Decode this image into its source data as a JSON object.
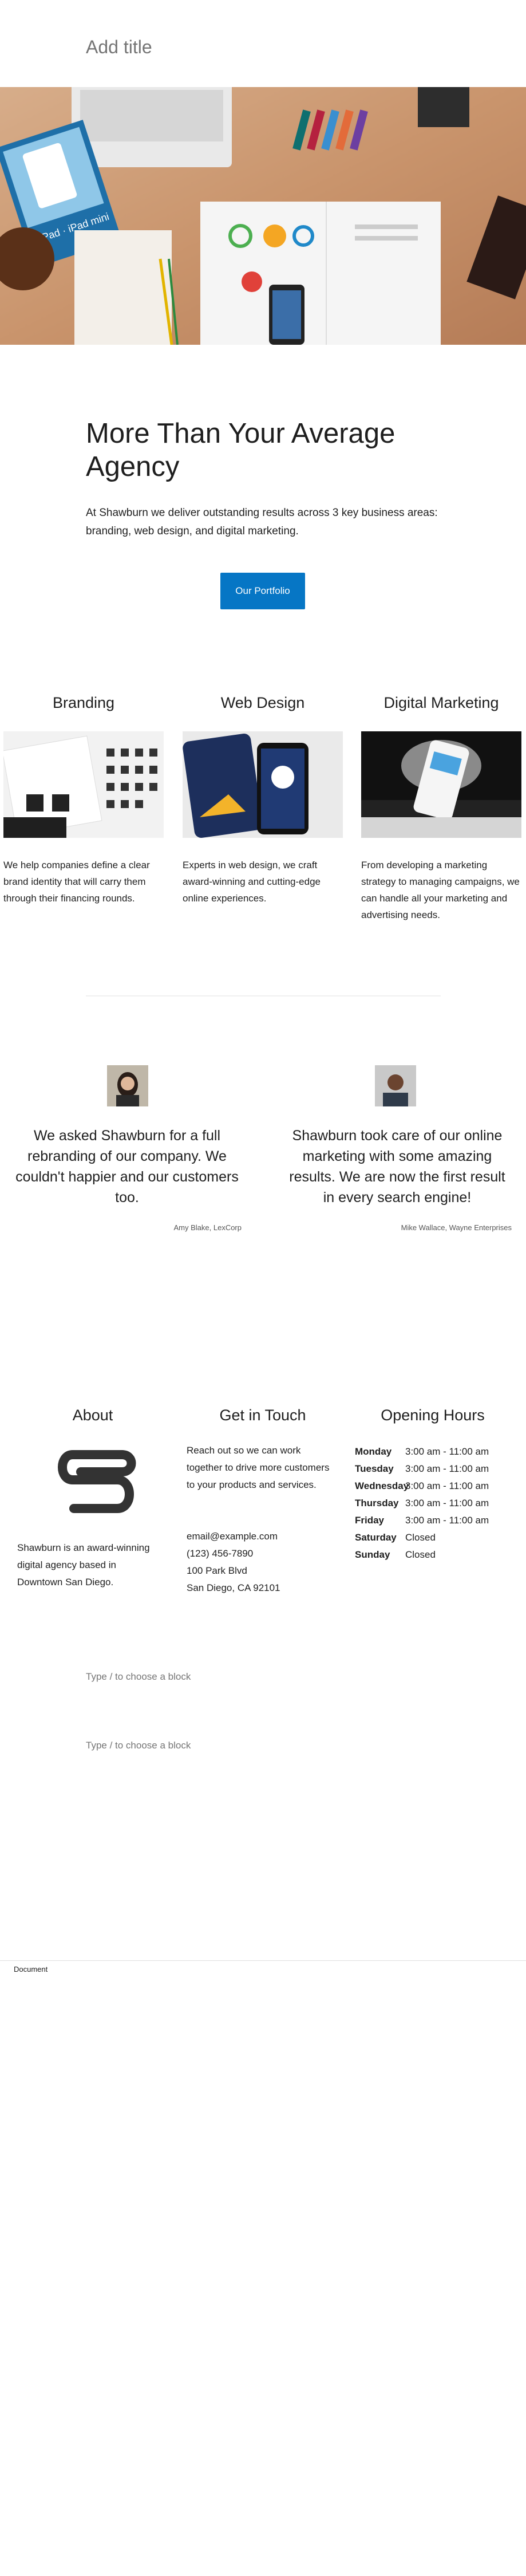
{
  "editor": {
    "title_placeholder": "Add title",
    "status_label": "Document",
    "block_placeholder_1": "Type / to choose a block",
    "block_placeholder_2": "Type / to choose a block"
  },
  "hero": {
    "icons": [
      "ipad-box-icon",
      "keyboard-icon",
      "magazine-icon",
      "phone-icon",
      "pencil-icon",
      "color-swatches-icon"
    ],
    "box_label": "iPad · iPad mini"
  },
  "intro": {
    "headline": "More Than Your Average Agency",
    "description": "At Shawburn we deliver outstanding results across 3 key business areas: branding, web design, and digital marketing.",
    "button_label": "Our Portfolio",
    "button_color": "#0676c5"
  },
  "services": [
    {
      "title": "Branding",
      "text": "We help companies define a clear brand identity that will carry them through their financing rounds."
    },
    {
      "title": "Web Design",
      "text": "Experts in web design, we craft award-winning and cutting-edge online experiences."
    },
    {
      "title": "Digital Marketing",
      "text": "From developing a marketing strategy to managing campaigns, we can handle all your marketing and advertising needs."
    }
  ],
  "testimonials": [
    {
      "quote": "We asked Shawburn for a full rebranding of our company. We couldn't happier and our customers too.",
      "cite": "Amy Blake, LexCorp"
    },
    {
      "quote": "Shawburn took care of our online marketing with some amazing results. We are now the first result in every search engine!",
      "cite": "Mike Wallace, Wayne Enterprises"
    }
  ],
  "footer": {
    "about_title": "About",
    "about_text": "Shawburn is an award-winning digital agency based in Downtown San Diego.",
    "contact_title": "Get in Touch",
    "contact_text": "Reach out so we can work together to drive more customers to your products and services.",
    "email": "email@example.com",
    "phone": "(123) 456-7890",
    "address1": "100 Park Blvd",
    "address2": "San Diego, CA 92101",
    "hours_title": "Opening Hours",
    "hours": [
      {
        "day": "Monday",
        "time": "3:00 am - 11:00 am"
      },
      {
        "day": "Tuesday",
        "time": "3:00 am - 11:00 am"
      },
      {
        "day": "Wednesday",
        "time": "3:00 am - 11:00 am"
      },
      {
        "day": "Thursday",
        "time": "3:00 am - 11:00 am"
      },
      {
        "day": "Friday",
        "time": "3:00 am - 11:00 am"
      },
      {
        "day": "Saturday",
        "time": "Closed"
      },
      {
        "day": "Sunday",
        "time": "Closed"
      }
    ]
  }
}
